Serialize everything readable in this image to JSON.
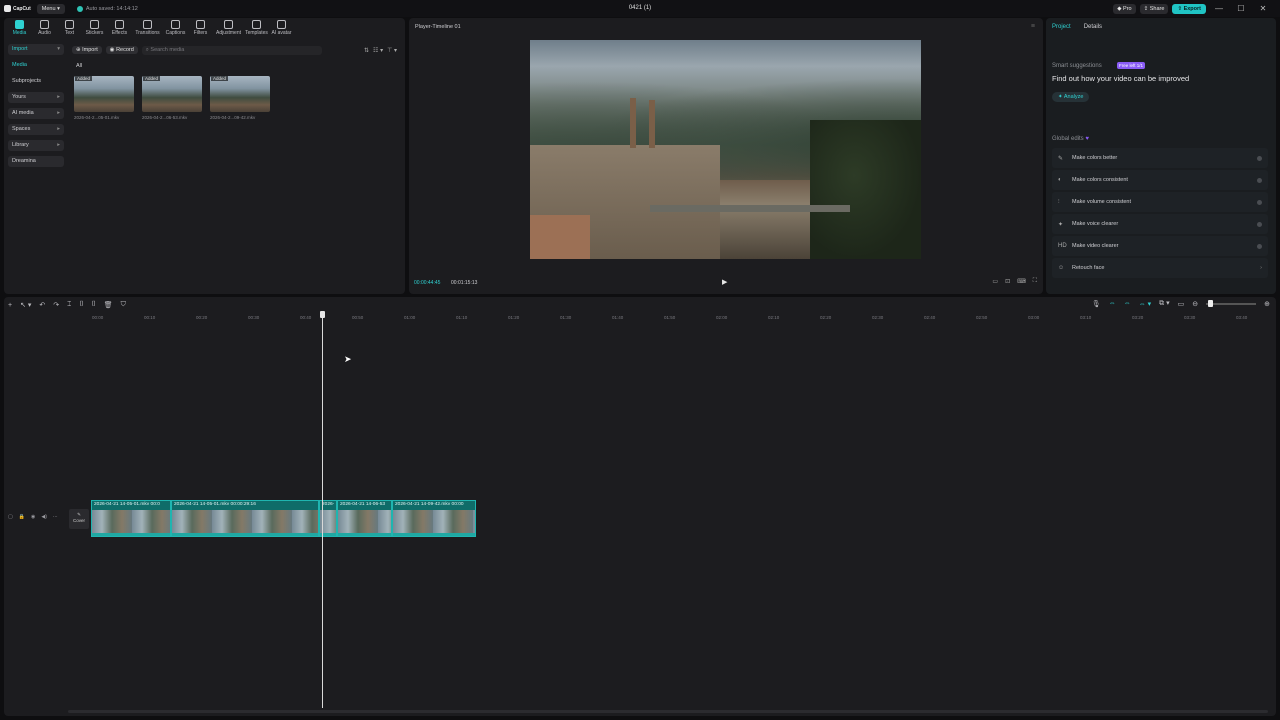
{
  "titlebar": {
    "app_name": "CapCut",
    "menu_label": "Menu",
    "autosave_text": "Auto saved: 14:14:12",
    "project_title": "0421 (1)",
    "pro_label": "Pro",
    "share_label": "Share",
    "export_label": "Export"
  },
  "media_toolbar": [
    {
      "name": "media",
      "label": "Media",
      "active": true
    },
    {
      "name": "audio",
      "label": "Audio"
    },
    {
      "name": "text",
      "label": "Text"
    },
    {
      "name": "stickers",
      "label": "Stickers"
    },
    {
      "name": "effects",
      "label": "Effects"
    },
    {
      "name": "transitions",
      "label": "Transitions"
    },
    {
      "name": "captions",
      "label": "Captions"
    },
    {
      "name": "filters",
      "label": "Filters"
    },
    {
      "name": "adjustment",
      "label": "Adjustment"
    },
    {
      "name": "templates",
      "label": "Templates"
    },
    {
      "name": "ai-avatar",
      "label": "AI avatar"
    }
  ],
  "sidebar": {
    "items": [
      {
        "label": "Import",
        "boxed": true,
        "active": true,
        "arrow": "▾"
      },
      {
        "label": "Media",
        "boxed": false,
        "active": true
      },
      {
        "label": "Subprojects",
        "boxed": false
      },
      {
        "label": "Yours",
        "boxed": true,
        "arrow": "▸"
      },
      {
        "label": "AI media",
        "boxed": true,
        "arrow": "▸"
      },
      {
        "label": "Spaces",
        "boxed": true,
        "arrow": "▸"
      },
      {
        "label": "Library",
        "boxed": true,
        "arrow": "▸"
      },
      {
        "label": "Dreamina",
        "boxed": true
      }
    ]
  },
  "media": {
    "import_label": "Import",
    "record_label": "Record",
    "search_placeholder": "Search media",
    "filter_all": "All",
    "thumbs": [
      {
        "badge": "Added",
        "name": "2026-04-2...05-01.mkv"
      },
      {
        "badge": "Added",
        "name": "2026-04-2...06-53.mkv"
      },
      {
        "badge": "Added",
        "name": "2026-04-2...09-42.mkv"
      }
    ]
  },
  "player": {
    "title": "Player-Timeline 01",
    "current_time": "00:00:44:45",
    "total_time": "00:01:15:13"
  },
  "right_panel": {
    "tabs": [
      "Project",
      "Details"
    ],
    "smart_label": "Smart suggestions",
    "badge": "Free left 1/1",
    "smart_title": "Find out how your video can be improved",
    "analyze_label": "Analyze",
    "global_label": "Global edits",
    "global_items": [
      {
        "label": "Make colors better",
        "icon": "✎",
        "control": "toggle"
      },
      {
        "label": "Make colors consistent",
        "icon": "◐",
        "control": "toggle"
      },
      {
        "label": "Make volume consistent",
        "icon": "⫶",
        "control": "toggle"
      },
      {
        "label": "Make voice clearer",
        "icon": "✦",
        "control": "toggle"
      },
      {
        "label": "Make video clearer",
        "icon": "HD",
        "control": "toggle"
      },
      {
        "label": "Retouch face",
        "icon": "☺",
        "control": "chevron"
      }
    ]
  },
  "timeline": {
    "ticks": [
      "00:00",
      "00:10",
      "00:20",
      "00:30",
      "00:40",
      "00:50",
      "01:00",
      "01:10",
      "01:20",
      "01:30",
      "01:40",
      "01:50",
      "02:00",
      "02:10",
      "02:20",
      "02:30",
      "02:40",
      "02:50",
      "03:00",
      "03:10",
      "03:20",
      "03:30",
      "03:40"
    ],
    "cover_label": "Cover",
    "clips": [
      {
        "name": "2026-04-21 14-05-01.mkv  00:0"
      },
      {
        "name": "2026-04-21 14-05-01.mkv  00:00:29:16"
      },
      {
        "name": "2026-"
      },
      {
        "name": "2026-04-21 14-06-53"
      },
      {
        "name": "2026-04-21 14-09-42.mkv  00:00"
      }
    ]
  }
}
